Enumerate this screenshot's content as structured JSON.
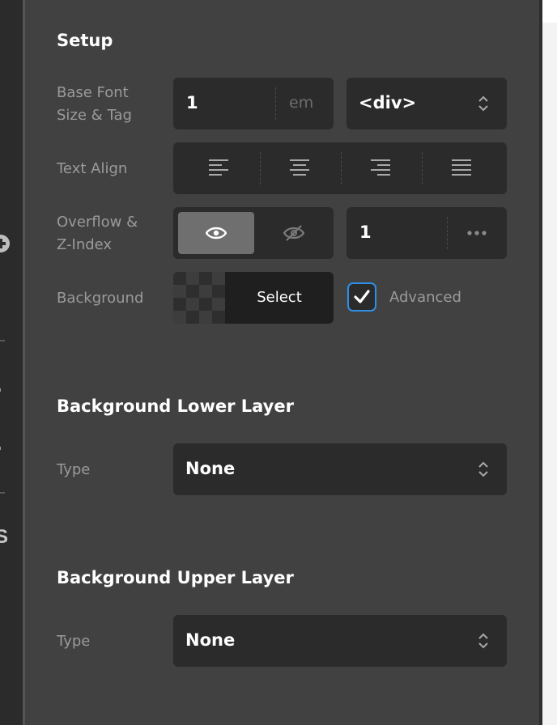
{
  "setup": {
    "title": "Setup",
    "base_font": {
      "label_line1": "Base Font",
      "label_line2": "Size & Tag",
      "value": "1",
      "unit": "em",
      "tag": "<div>"
    },
    "text_align": {
      "label": "Text Align",
      "options": [
        "align-left",
        "align-center",
        "align-right",
        "align-justify"
      ]
    },
    "overflow": {
      "label_line1": "Overflow &",
      "label_line2": "Z-Index",
      "options": [
        "visible",
        "hidden"
      ],
      "selected": "visible",
      "z_index": "1"
    },
    "background": {
      "label": "Background",
      "select_label": "Select",
      "advanced_label": "Advanced",
      "advanced_checked": true
    }
  },
  "lower_layer": {
    "title": "Background Lower Layer",
    "type_label": "Type",
    "type_value": "None"
  },
  "upper_layer": {
    "title": "Background Upper Layer",
    "type_label": "Type",
    "type_value": "None"
  },
  "colors": {
    "panel_bg": "#414141",
    "control_bg": "#2b2b2b",
    "accent_blue": "#2f8fe6",
    "active_segment": "#6f6f6f"
  }
}
